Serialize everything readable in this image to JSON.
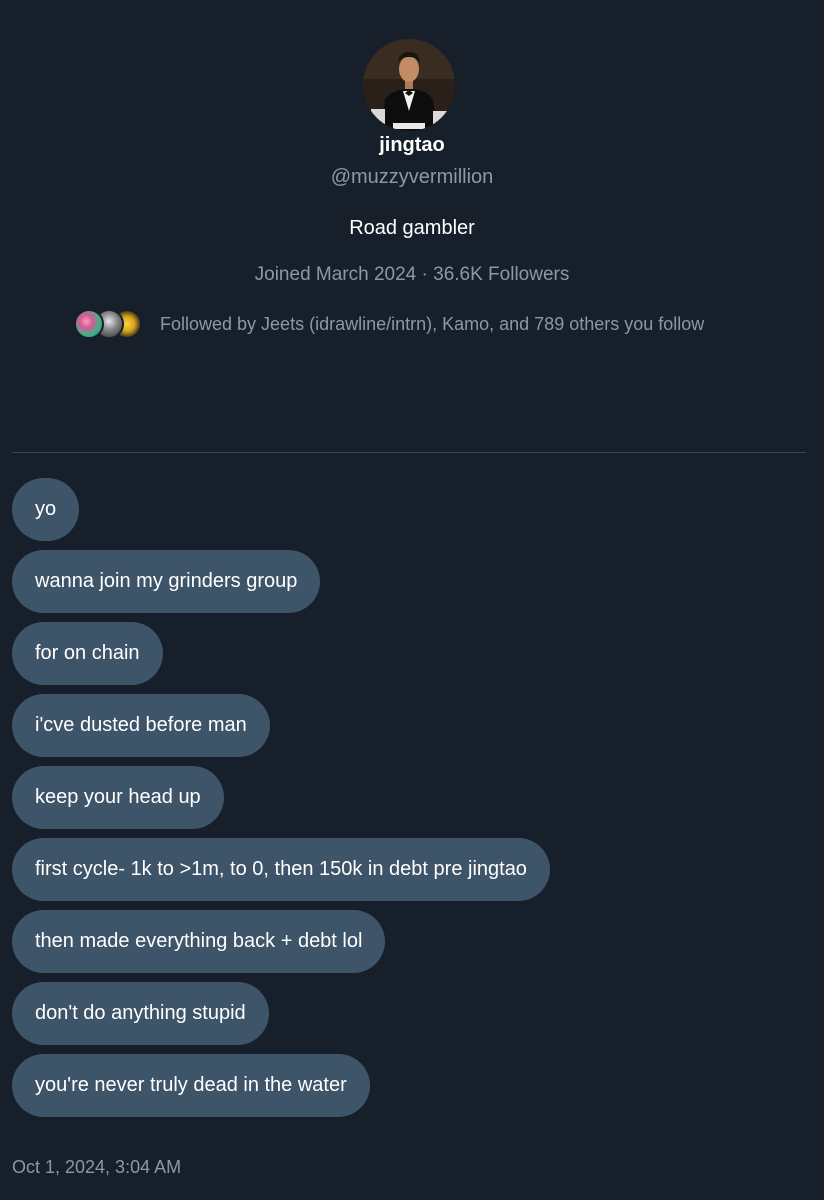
{
  "profile": {
    "display_name": "jingtao",
    "handle": "@muzzyvermillion",
    "bio": "Road gambler",
    "meta": "Joined March 2024 · 36.6K Followers",
    "followed_by": "Followed by Jeets (idrawline/intrn), Kamo, and 789 others you follow"
  },
  "messages": [
    "yo",
    "wanna join my grinders group",
    "for on chain",
    "i'cve dusted before man",
    "keep your head up",
    "first cycle- 1k to >1m, to 0, then 150k in debt pre jingtao",
    "then made everything back + debt lol",
    "don't do anything stupid",
    "you're never truly dead in the water"
  ],
  "timestamp": "Oct 1, 2024, 3:04 AM",
  "colors": {
    "background": "#17202a",
    "bubble": "#3e5468",
    "secondary_text": "#8b98a5",
    "divider": "#38444d"
  }
}
